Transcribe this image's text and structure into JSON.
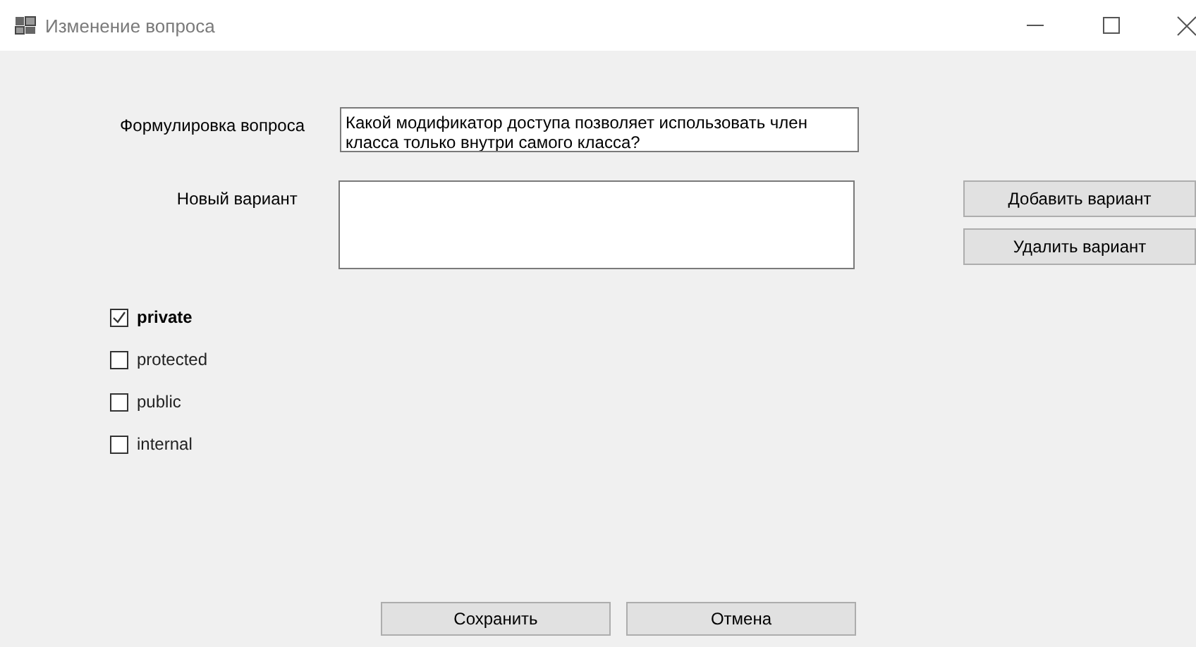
{
  "window": {
    "title": "Изменение вопроса"
  },
  "question": {
    "label": "Формулировка вопроса",
    "value": "Какой модификатор доступа позволяет использовать член класса только внутри самого класса?"
  },
  "new_option": {
    "label": "Новый вариант"
  },
  "option_buttons": [
    "Добавить вариант",
    "Удалить вариант"
  ],
  "options": [
    {
      "label": "private",
      "checked": true
    },
    {
      "label": "protected",
      "checked": false
    },
    {
      "label": "public",
      "checked": false
    },
    {
      "label": "internal",
      "checked": false
    }
  ],
  "buttons": [
    "Сохранить",
    "Отмена"
  ]
}
